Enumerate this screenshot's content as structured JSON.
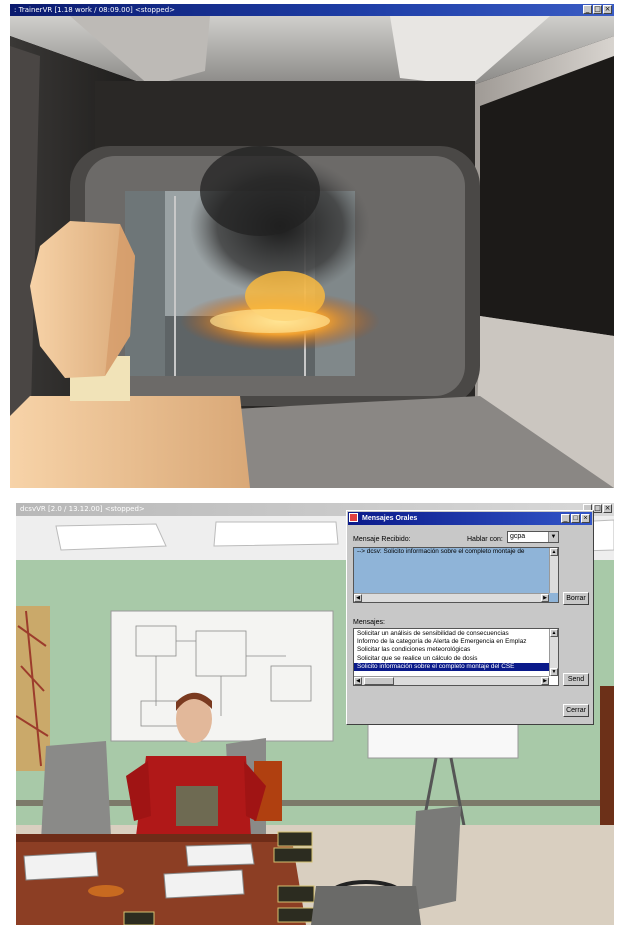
{
  "top_window": {
    "title": ": TrainerVR [1.18 work / 08:09.00] <stopped>"
  },
  "bottom_window": {
    "title": "dcsvVR [2.0 / 13.12.00] <stopped>"
  },
  "dialog": {
    "title": "Mensajes Orales",
    "received_label": "Mensaje Recibido:",
    "talk_with_label": "Hablar con:",
    "talk_with_value": "gcpa",
    "received_text": "--> dcsv: Solicito información sobre el completo montaje de",
    "delete_button": "Borrar",
    "messages_label": "Mensajes:",
    "messages": [
      "Solicitar un análisis de sensibilidad de consecuencias",
      "Informo de la categoría de Alerta de Emergencia en Emplaz",
      "Solicitar las condiciones meteorológicas",
      "Solicitar que se realice un cálculo de dosis",
      "Solicito información sobre el completo montaje del CSE"
    ],
    "selected_message_index": 4,
    "send_button": "Send",
    "close_button": "Cerrar"
  },
  "colors": {
    "titlebar_active": "#0a1a6e",
    "selection": "#0a1a8a",
    "received_bg": "#8fb4d8",
    "wall": "#a8c9a8"
  }
}
